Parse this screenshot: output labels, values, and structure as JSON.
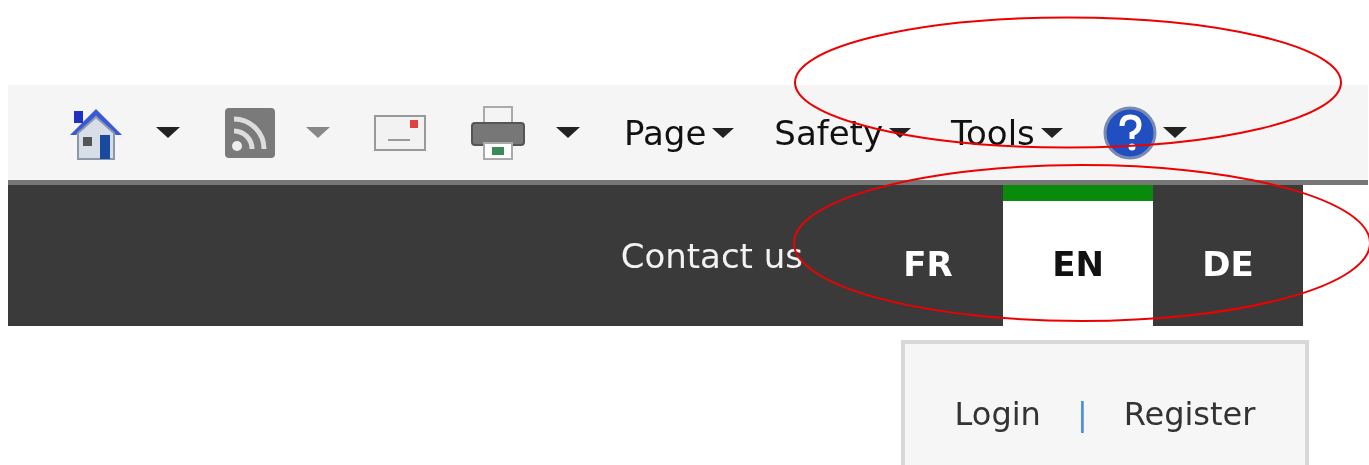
{
  "toolbar": {
    "buttons": [
      {
        "kind": "home",
        "dropdown_disabled": false
      },
      {
        "kind": "feeds",
        "dropdown_disabled": true
      },
      {
        "kind": "mail"
      },
      {
        "kind": "print",
        "dropdown_disabled": false
      }
    ],
    "menus": [
      "Page",
      "Safety",
      "Tools"
    ],
    "help": {
      "dropdown_disabled": false
    }
  },
  "nav": {
    "contact": "Contact us",
    "languages": [
      {
        "label": "FR",
        "selected": false
      },
      {
        "label": "EN",
        "selected": true
      },
      {
        "label": "DE",
        "selected": false
      }
    ]
  },
  "account_panel": {
    "login": "Login",
    "separator": "|",
    "register": "Register"
  }
}
